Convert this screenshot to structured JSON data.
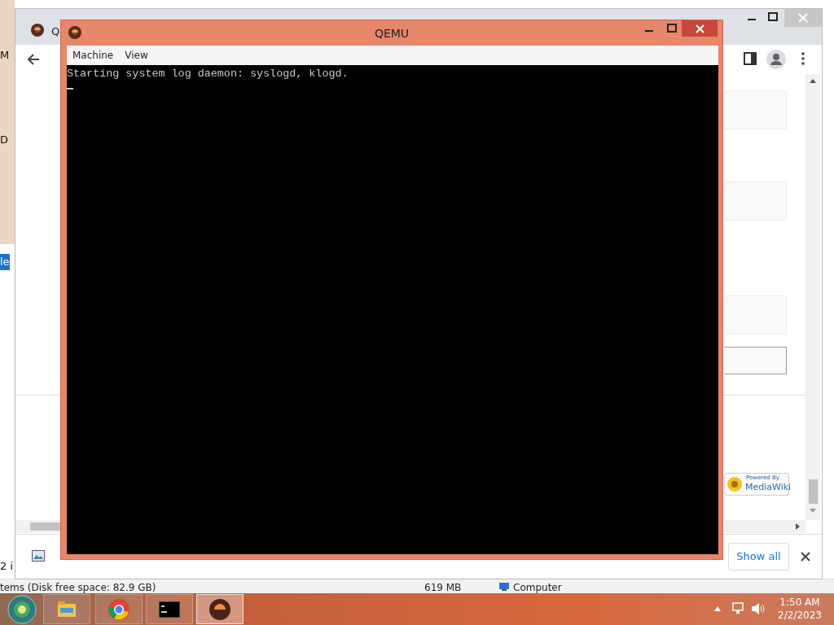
{
  "explorer_window": {
    "edge_fragments": [
      "M",
      "D",
      "le",
      "2 i"
    ],
    "status_bar": {
      "items": "tems (Disk free space: 82.9 GB)",
      "size": "619 MB",
      "location": "Computer"
    }
  },
  "browser": {
    "tab_title": "Q",
    "powered_by": {
      "line1": "Powered By",
      "line2": "MediaWiki"
    },
    "download_shelf": {
      "show_all": "Show all"
    }
  },
  "qemu": {
    "title": "QEMU",
    "menu": [
      "Machine",
      "View"
    ],
    "console_lines": [
      "Starting system log daemon: syslogd, klogd."
    ]
  },
  "taskbar": {
    "apps": [
      {
        "kind": "explorer",
        "selected": false
      },
      {
        "kind": "chrome",
        "selected": false
      },
      {
        "kind": "terminal",
        "selected": false
      },
      {
        "kind": "qemu",
        "selected": true
      }
    ],
    "clock": {
      "time": "1:50 AM",
      "date": "2/2/2023"
    }
  }
}
